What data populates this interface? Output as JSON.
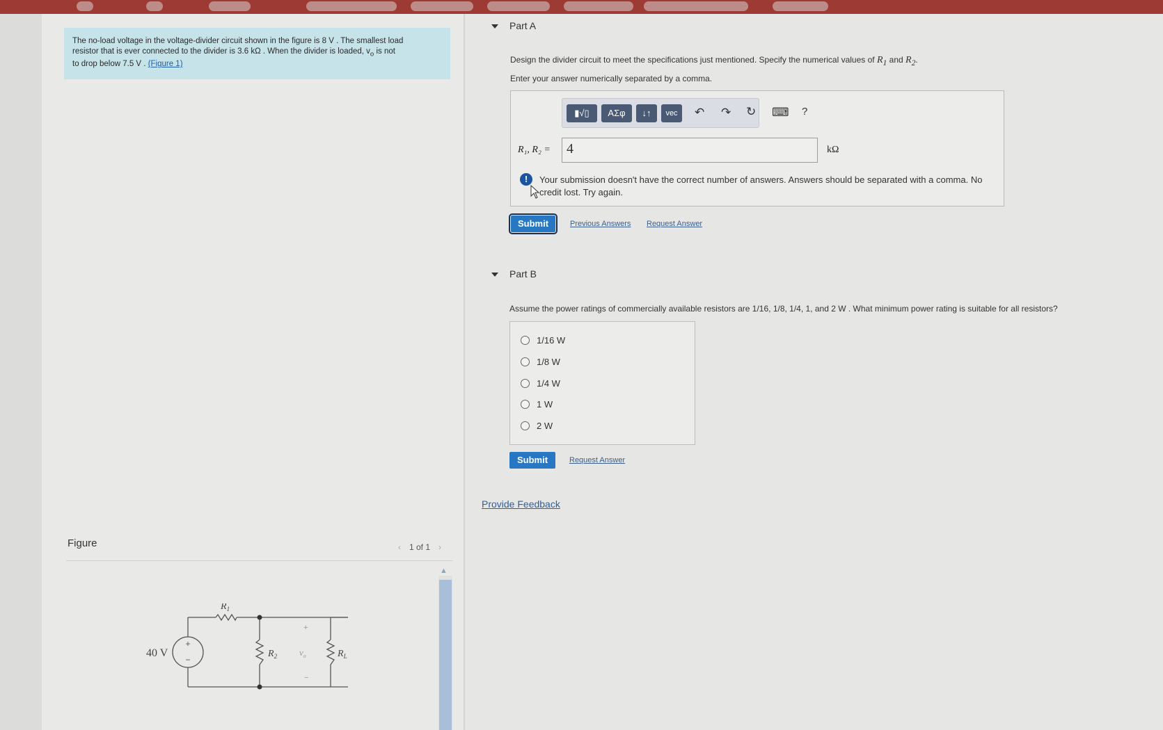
{
  "problem": {
    "text_line1": "The no-load voltage in the voltage-divider circuit shown in the figure is 8 V . The smallest load",
    "text_line2": "resistor that is ever connected to the divider is 3.6 kΩ . When the divider is loaded, v",
    "text_line2_sub": "o",
    "text_line2_end": " is not",
    "text_line3": "to drop below 7.5 V .",
    "figure_link": "(Figure 1)"
  },
  "figure": {
    "label": "Figure",
    "pager": "1 of 1",
    "source_label": "40 V",
    "r1": "R",
    "r1_sub": "1",
    "r2": "R",
    "r2_sub": "2",
    "rl": "R",
    "rl_sub": "L",
    "vo": "v",
    "vo_sub": "o",
    "plus": "+",
    "minus": "−"
  },
  "partA": {
    "title": "Part A",
    "question_pre": "Design the divider circuit to meet the specifications just mentioned. Specify the numerical values of ",
    "question_r1": "R",
    "question_r1_sub": "1",
    "question_and": " and ",
    "question_r2": "R",
    "question_r2_sub": "2",
    "question_end": ".",
    "instruction": "Enter your answer numerically separated by a comma.",
    "toolbar": {
      "templates": "▮√▯",
      "greek": "ΑΣφ",
      "arrows": "↓↑",
      "vec": "vec",
      "undo": "↶",
      "redo": "↷",
      "reset": "↻",
      "keyboard": "⌨",
      "help": "?"
    },
    "answer_label": "R₁, R₂ =",
    "answer_value": "4",
    "unit": "kΩ",
    "error_icon": "!",
    "error_text": "Your submission doesn't have the correct number of answers. Answers should be separated with a comma. No credit lost. Try again.",
    "submit": "Submit",
    "previous_answers": "Previous Answers",
    "request_answer": "Request Answer"
  },
  "partB": {
    "title": "Part B",
    "question": "Assume the power ratings of commercially available resistors are 1/16, 1/8, 1/4, 1, and 2 W . What minimum power rating is suitable for all resistors?",
    "options": [
      "1/16 W",
      "1/8 W",
      "1/4 W",
      "1 W",
      "2 W"
    ],
    "submit": "Submit",
    "request_answer": "Request Answer"
  },
  "provide_feedback": "Provide Feedback",
  "colors": {
    "accent": "#2877c3",
    "problem_bg": "#c6e3ea",
    "toolbar_btn": "#4a5a74",
    "topbar": "#9c3a33"
  }
}
